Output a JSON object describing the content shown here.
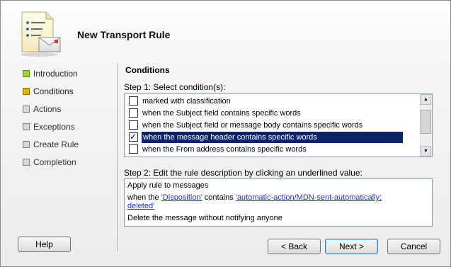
{
  "wizard": {
    "title": "New Transport Rule"
  },
  "nav": [
    {
      "label": "Introduction",
      "state": "done"
    },
    {
      "label": "Conditions",
      "state": "active"
    },
    {
      "label": "Actions",
      "state": "pending"
    },
    {
      "label": "Exceptions",
      "state": "pending"
    },
    {
      "label": "Create Rule",
      "state": "pending"
    },
    {
      "label": "Completion",
      "state": "pending"
    }
  ],
  "content": {
    "section_title": "Conditions",
    "step1_label": "Step 1: Select condition(s):",
    "conditions": [
      {
        "label": "marked with classification",
        "checked": false,
        "selected": false
      },
      {
        "label": "when the Subject field contains specific words",
        "checked": false,
        "selected": false
      },
      {
        "label": "when the Subject field or message body contains specific words",
        "checked": false,
        "selected": false
      },
      {
        "label": "when the message header contains specific words",
        "checked": true,
        "selected": true
      },
      {
        "label": "when the From address contains specific words",
        "checked": false,
        "selected": false
      }
    ],
    "step2_label": "Step 2: Edit the rule description by clicking an underlined value:",
    "description": {
      "line1": "Apply rule to messages",
      "line2_prefix": "when the ",
      "line2_link1": "'Disposition'",
      "line2_middle": " contains ",
      "line2_link2a": "'automatic-action/MDN-sent-automatically;",
      "line2_link2b": "deleted'",
      "line3": "Delete the message without notifying anyone"
    }
  },
  "buttons": {
    "help": "Help",
    "back": "< Back",
    "next": "Next >",
    "cancel": "Cancel"
  }
}
